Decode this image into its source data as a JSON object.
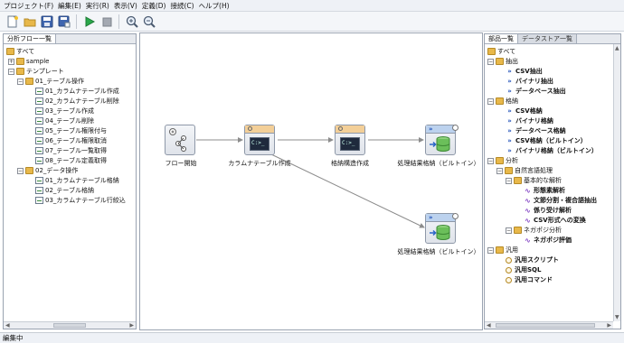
{
  "menu": [
    "プロジェクト(F)",
    "編集(E)",
    "実行(R)",
    "表示(V)",
    "定義(D)",
    "接続(C)",
    "ヘルプ(H)"
  ],
  "toolbar": [
    "new-icon",
    "open-icon",
    "save-icon",
    "save-as-icon",
    "run-icon",
    "stop-icon",
    "zoom-in-icon",
    "zoom-out-icon"
  ],
  "left_panel": {
    "tab": "分析フロー一覧",
    "tree": [
      {
        "label": "すべて"
      },
      {
        "label": "sample"
      },
      {
        "label": "テンプレート"
      },
      {
        "label": "01_テーブル操作"
      },
      {
        "label": "01_カラムナテーブル作成"
      },
      {
        "label": "02_カラムナテーブル削除"
      },
      {
        "label": "03_テーブル作成"
      },
      {
        "label": "04_テーブル削除"
      },
      {
        "label": "05_テーブル権限付与"
      },
      {
        "label": "06_テーブル権限取消"
      },
      {
        "label": "07_テーブル一覧取得"
      },
      {
        "label": "08_テーブル定義取得"
      },
      {
        "label": "02_データ操作"
      },
      {
        "label": "01_カラムナテーブル格納"
      },
      {
        "label": "02_テーブル格納"
      },
      {
        "label": "03_カラムナテーブル行絞込"
      }
    ]
  },
  "canvas": {
    "nodes": [
      {
        "label": "フロー開始"
      },
      {
        "label": "カラムナテーブル作成"
      },
      {
        "label": "格納構造作成"
      },
      {
        "label": "処理結果格納（ビルトイン）"
      },
      {
        "label": "処理結果格納（ビルトイン）"
      }
    ]
  },
  "right_panel": {
    "tabs": [
      "部品一覧",
      "データストア一覧"
    ],
    "tree": [
      {
        "label": "すべて"
      },
      {
        "label": "抽出"
      },
      {
        "label": "CSV抽出"
      },
      {
        "label": "バイナリ抽出"
      },
      {
        "label": "データベース抽出"
      },
      {
        "label": "格納"
      },
      {
        "label": "CSV格納"
      },
      {
        "label": "バイナリ格納"
      },
      {
        "label": "データベース格納"
      },
      {
        "label": "CSV格納（ビルトイン）"
      },
      {
        "label": "バイナリ格納（ビルトイン）"
      },
      {
        "label": "分析"
      },
      {
        "label": "自然言語処理"
      },
      {
        "label": "基本的な解析"
      },
      {
        "label": "形態素解析"
      },
      {
        "label": "文節分割・複合語抽出"
      },
      {
        "label": "係り受け解析"
      },
      {
        "label": "CSV形式への変換"
      },
      {
        "label": "ネガポジ分析"
      },
      {
        "label": "ネガポジ評価"
      },
      {
        "label": "汎用"
      },
      {
        "label": "汎用スクリプト"
      },
      {
        "label": "汎用SQL"
      },
      {
        "label": "汎用コマンド"
      }
    ]
  },
  "status": "編集中"
}
